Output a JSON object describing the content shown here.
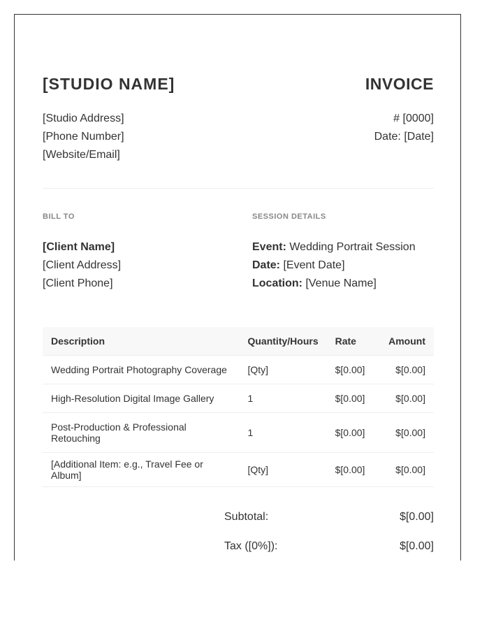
{
  "studio": {
    "name": "[STUDIO NAME]",
    "address": "[Studio Address]",
    "phone": "[Phone Number]",
    "web": "[Website/Email]"
  },
  "invoice": {
    "title": "INVOICE",
    "number": "# [0000]",
    "date": "Date: [Date]"
  },
  "bill_to": {
    "label": "BILL TO",
    "client_name": "[Client Name]",
    "client_address": "[Client Address]",
    "client_phone": "[Client Phone]"
  },
  "session": {
    "label": "SESSION DETAILS",
    "event_key": "Event:",
    "event_value": " Wedding Portrait Session",
    "date_key": "Date:",
    "date_value": " [Event Date]",
    "location_key": "Location:",
    "location_value": " [Venue Name]"
  },
  "table": {
    "headers": {
      "description": "Description",
      "quantity": "Quantity/Hours",
      "rate": "Rate",
      "amount": "Amount"
    },
    "rows": [
      {
        "description": "Wedding Portrait Photography Coverage",
        "quantity": "[Qty]",
        "rate": "$[0.00]",
        "amount": "$[0.00]"
      },
      {
        "description": "High-Resolution Digital Image Gallery",
        "quantity": "1",
        "rate": "$[0.00]",
        "amount": "$[0.00]"
      },
      {
        "description": "Post-Production & Professional Retouching",
        "quantity": "1",
        "rate": "$[0.00]",
        "amount": "$[0.00]"
      },
      {
        "description": "[Additional Item: e.g., Travel Fee or Album]",
        "quantity": "[Qty]",
        "rate": "$[0.00]",
        "amount": "$[0.00]"
      }
    ]
  },
  "totals": {
    "subtotal_label": "Subtotal:",
    "subtotal_value": "$[0.00]",
    "tax_label": "Tax ([0%]):",
    "tax_value": "$[0.00]"
  }
}
